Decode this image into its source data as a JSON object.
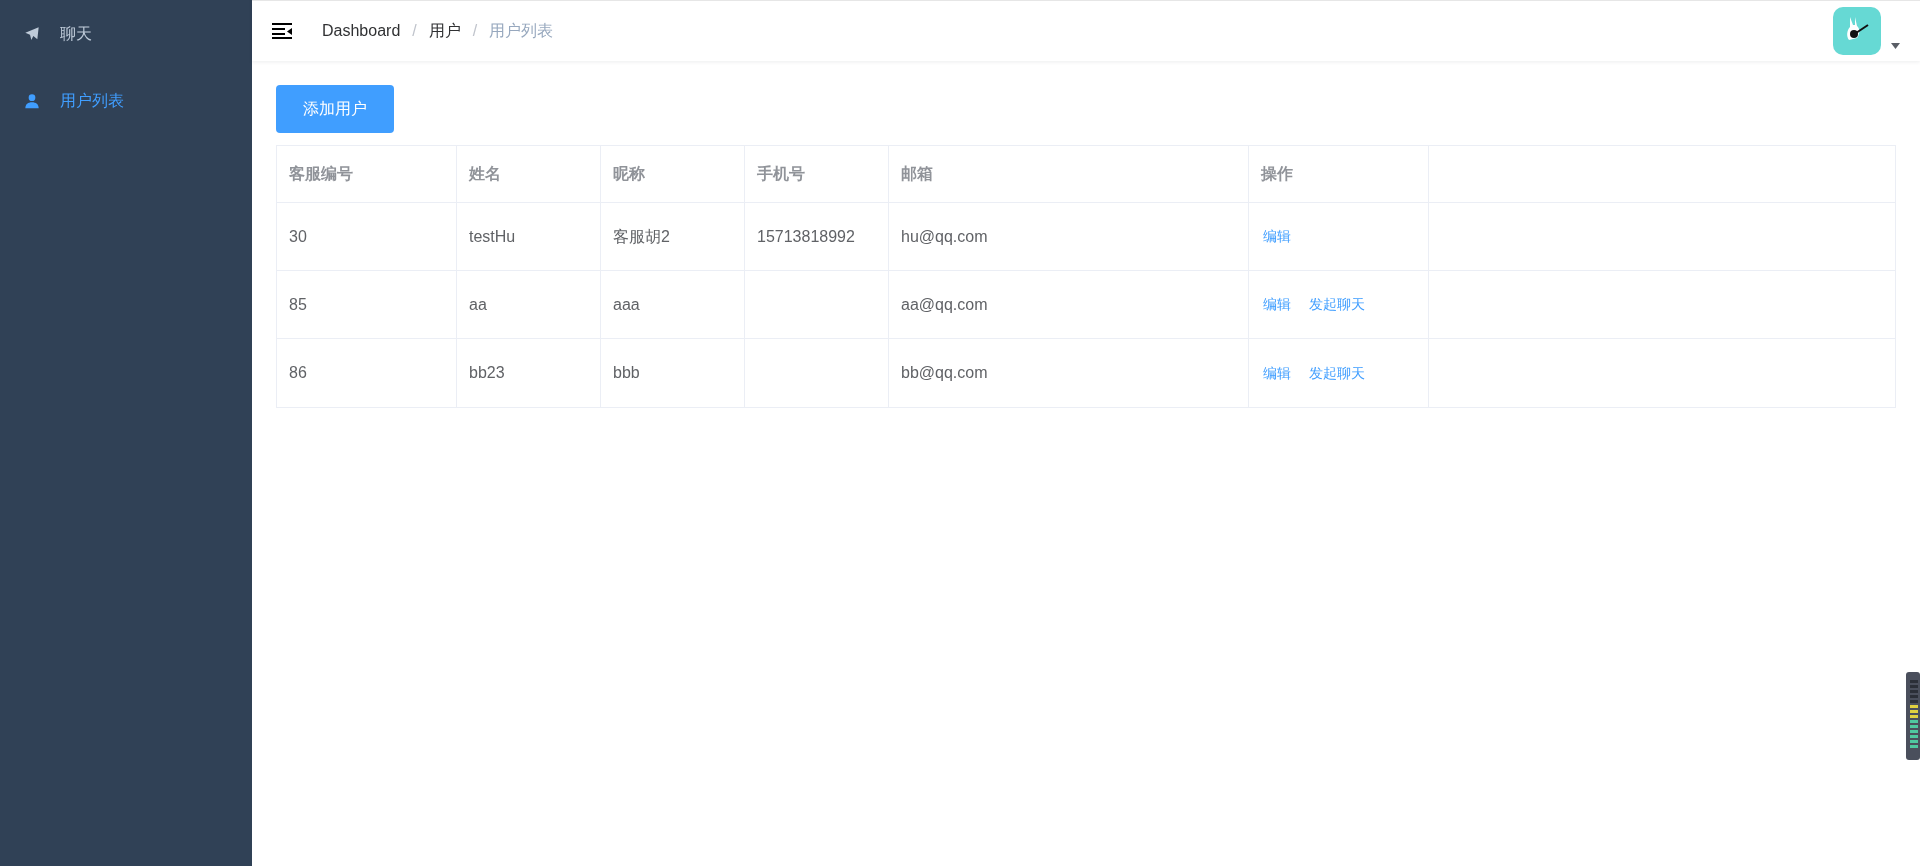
{
  "sidebar": {
    "items": [
      {
        "label": "聊天",
        "kind": "send",
        "selected": false
      },
      {
        "label": "用户列表",
        "kind": "user",
        "selected": true
      }
    ]
  },
  "breadcrumb": [
    {
      "label": "Dashboard",
      "current": false
    },
    {
      "separator": "/",
      "label": "用户",
      "current": false
    },
    {
      "separator": "/",
      "label": "用户列表",
      "current": true
    }
  ],
  "add_button": "添加用户",
  "table": {
    "columns": [
      "客服编号",
      "姓名",
      "昵称",
      "手机号",
      "邮箱",
      "操作"
    ],
    "rows": [
      {
        "cells": [
          "30",
          "testHu",
          "客服胡2",
          "15713818992",
          "hu@qq.com"
        ],
        "actions": [
          "编辑"
        ]
      },
      {
        "cells": [
          "85",
          "aa",
          "aaa",
          "",
          "aa@qq.com"
        ],
        "actions": [
          "编辑",
          "发起聊天"
        ]
      },
      {
        "cells": [
          "86",
          "bb23",
          "bbb",
          "",
          "bb@qq.com"
        ],
        "actions": [
          "编辑",
          "发起聊天"
        ]
      }
    ]
  }
}
